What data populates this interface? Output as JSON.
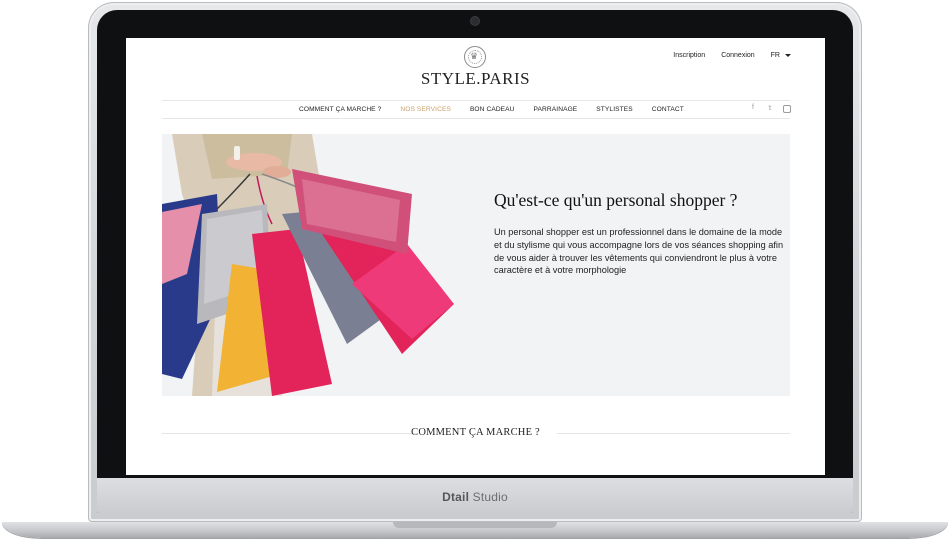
{
  "laptop": {
    "brand_bold": "Dtail",
    "brand_rest": "Studio"
  },
  "site": {
    "logo": "STYLE.PARIS",
    "account": {
      "signup": "Inscription",
      "login": "Connexion",
      "lang": "FR"
    },
    "nav": [
      {
        "label": "COMMENT ÇA MARCHE ?",
        "active": false
      },
      {
        "label": "NOS SERVICES",
        "active": true
      },
      {
        "label": "BON CADEAU",
        "active": false
      },
      {
        "label": "PARRAINAGE",
        "active": false
      },
      {
        "label": "STYLISTES",
        "active": false
      },
      {
        "label": "CONTACT",
        "active": false
      }
    ],
    "social": {
      "facebook": "f",
      "twitter": "𝕥"
    },
    "hero": {
      "title": "Qu'est-ce qu'un personal shopper ?",
      "text": "Un personal shopper est un professionnel dans le domaine de la mode et du stylisme qui vous accompagne lors de vos séances shopping afin de vous aider à trouver les vêtements qui conviendront le plus à votre caractère et à votre morphologie"
    },
    "section_title": "COMMENT ÇA MARCHE ?"
  },
  "colors": {
    "accent": "#c9a06a",
    "hero_bg": "#f2f3f5"
  }
}
